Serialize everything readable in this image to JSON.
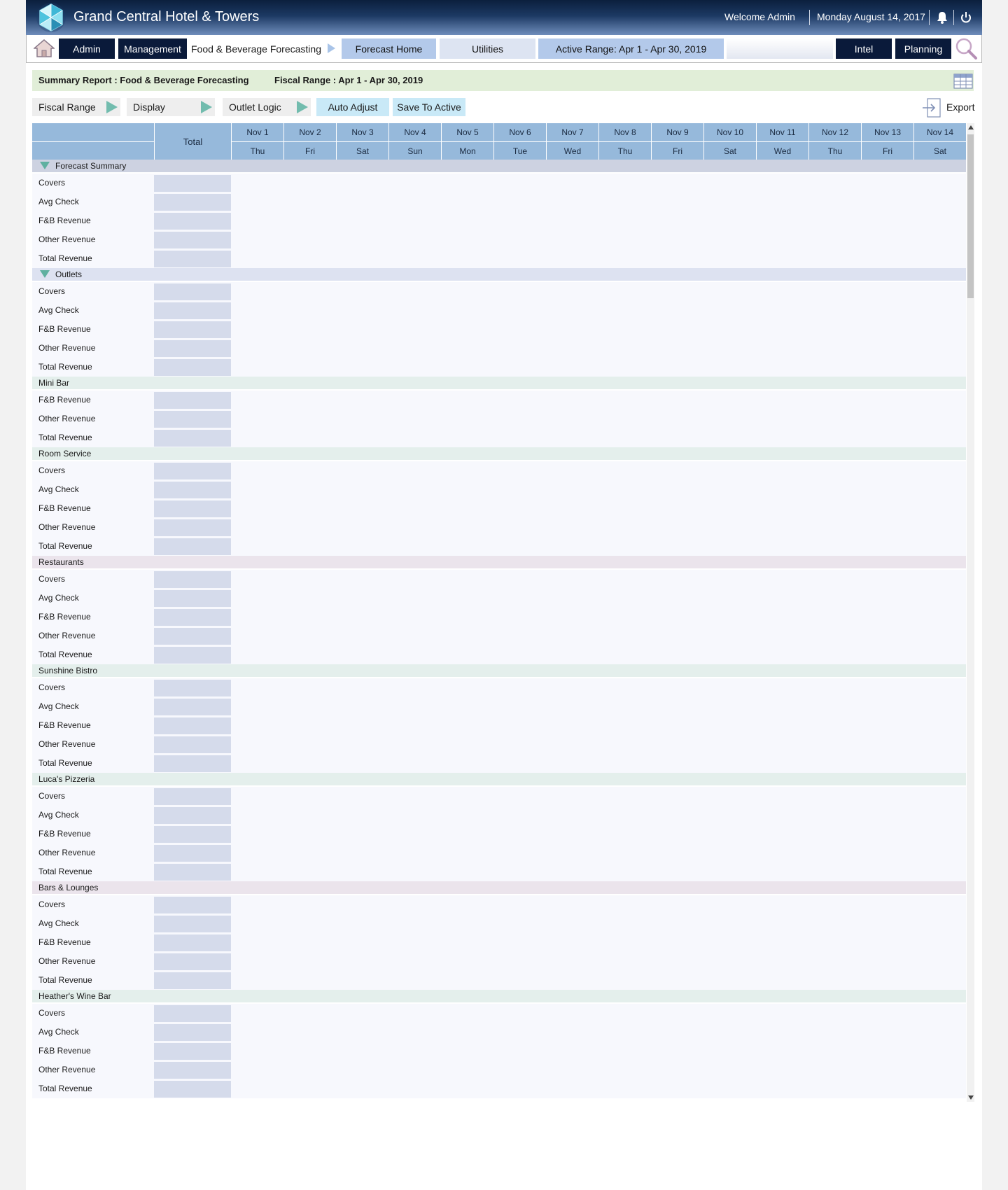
{
  "header": {
    "app_title": "Grand Central Hotel & Towers",
    "welcome": "Welcome Admin",
    "date": "Monday August 14, 2017",
    "icons": [
      "logo-icon",
      "bell-icon",
      "power-icon"
    ]
  },
  "nav": {
    "admin": "Admin",
    "management": "Management",
    "breadcrumb": "Food & Beverage Forecasting",
    "forecast_home": "Forecast Home",
    "utilities": "Utilities",
    "active_range": "Active Range: Apr 1 -  Apr 30, 2019",
    "intel": "Intel",
    "planning": "Planning",
    "icons": [
      "home-icon",
      "search-icon"
    ]
  },
  "summary": {
    "title": "Summary Report : Food & Beverage Forecasting",
    "fiscal_range": "Fiscal Range : Apr 1 -  Apr 30, 2019"
  },
  "controls": {
    "fiscal_range": "Fiscal Range",
    "display": "Display",
    "outlet_logic": "Outlet Logic",
    "auto_adjust": "Auto Adjust",
    "save_to_active": "Save To Active",
    "export": "Export"
  },
  "table": {
    "total_header": "Total",
    "columns": [
      {
        "date": "Nov 1",
        "day": "Thu"
      },
      {
        "date": "Nov 2",
        "day": "Fri"
      },
      {
        "date": "Nov 3",
        "day": "Sat"
      },
      {
        "date": "Nov 4",
        "day": "Sun"
      },
      {
        "date": "Nov 5",
        "day": "Mon"
      },
      {
        "date": "Nov 6",
        "day": "Tue"
      },
      {
        "date": "Nov 7",
        "day": "Wed"
      },
      {
        "date": "Nov 8",
        "day": "Thu"
      },
      {
        "date": "Nov 9",
        "day": "Fri"
      },
      {
        "date": "Nov 10",
        "day": "Sat"
      },
      {
        "date": "Nov 11",
        "day": "Wed"
      },
      {
        "date": "Nov 12",
        "day": "Thu"
      },
      {
        "date": "Nov 13",
        "day": "Fri"
      },
      {
        "date": "Nov 14",
        "day": "Sat"
      }
    ],
    "sections": [
      {
        "label": "Forecast Summary",
        "style": "grp",
        "collapsible": true,
        "rows": [
          "Covers",
          "Avg Check",
          "F&B Revenue",
          "Other Revenue",
          "Total Revenue"
        ]
      },
      {
        "label": "Outlets",
        "style": "grp2",
        "collapsible": true,
        "rows": [
          "Covers",
          "Avg Check",
          "F&B Revenue",
          "Other Revenue",
          "Total Revenue"
        ]
      },
      {
        "label": "Mini Bar",
        "style": "out",
        "collapsible": false,
        "rows": [
          "F&B Revenue",
          "Other Revenue",
          "Total Revenue"
        ]
      },
      {
        "label": "Room Service",
        "style": "out",
        "collapsible": false,
        "rows": [
          "Covers",
          "Avg Check",
          "F&B Revenue",
          "Other Revenue",
          "Total Revenue"
        ]
      },
      {
        "label": "Restaurants",
        "style": "cat",
        "collapsible": false,
        "rows": [
          "Covers",
          "Avg Check",
          "F&B Revenue",
          "Other Revenue",
          "Total Revenue"
        ]
      },
      {
        "label": "Sunshine Bistro",
        "style": "out",
        "collapsible": false,
        "rows": [
          "Covers",
          "Avg Check",
          "F&B Revenue",
          "Other Revenue",
          "Total Revenue"
        ]
      },
      {
        "label": "Luca's Pizzeria",
        "style": "out",
        "collapsible": false,
        "rows": [
          "Covers",
          "Avg Check",
          "F&B Revenue",
          "Other Revenue",
          "Total Revenue"
        ]
      },
      {
        "label": "Bars & Lounges",
        "style": "cat",
        "collapsible": false,
        "rows": [
          "Covers",
          "Avg Check",
          "F&B Revenue",
          "Other Revenue",
          "Total Revenue"
        ]
      },
      {
        "label": "Heather's Wine Bar",
        "style": "out",
        "collapsible": false,
        "rows": [
          "Covers",
          "Avg Check",
          "F&B Revenue",
          "Other Revenue",
          "Total Revenue"
        ]
      }
    ]
  }
}
